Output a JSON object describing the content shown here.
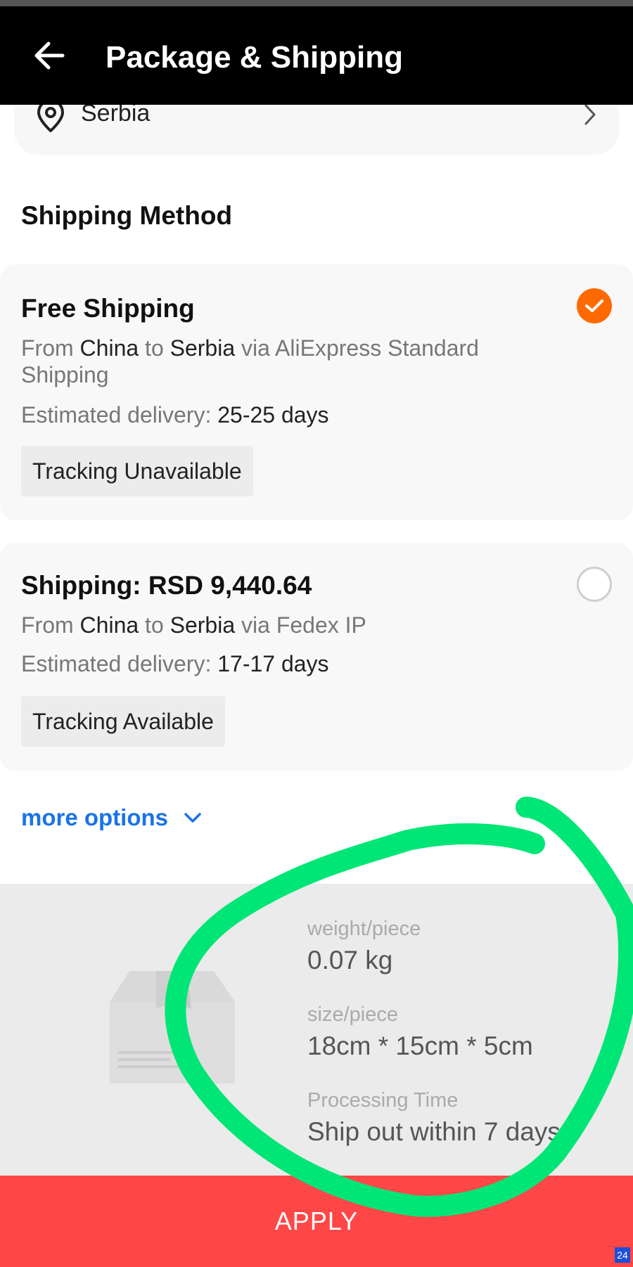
{
  "header": {
    "title": "Package & Shipping"
  },
  "address": {
    "country": "Serbia"
  },
  "shipping": {
    "section_title": "Shipping Method",
    "options": [
      {
        "title": "Free Shipping",
        "from_label": "From",
        "from": "China",
        "to_label": "to",
        "to": "Serbia",
        "via_label": "via",
        "carrier": "AliExpress Standard Shipping",
        "eta_label": "Estimated delivery:",
        "eta_value": "25-25 days",
        "tracking": "Tracking Unavailable",
        "selected": true
      },
      {
        "title": "Shipping: RSD 9,440.64",
        "from_label": "From",
        "from": "China",
        "to_label": "to",
        "to": "Serbia",
        "via_label": "via",
        "carrier": "Fedex IP",
        "eta_label": "Estimated delivery:",
        "eta_value": "17-17 days",
        "tracking": "Tracking Available",
        "selected": false
      }
    ],
    "more_options": "more options"
  },
  "package": {
    "weight_label": "weight/piece",
    "weight_value": "0.07 kg",
    "size_label": "size/piece",
    "size_value": "18cm * 15cm * 5cm",
    "processing_label": "Processing Time",
    "processing_value": "Ship out within 7 days"
  },
  "apply_label": "APPLY",
  "corner_badge": "24",
  "colors": {
    "accent": "#ff6a00",
    "link": "#1a73e8",
    "apply": "#ff4747",
    "highlight": "#00e676"
  }
}
